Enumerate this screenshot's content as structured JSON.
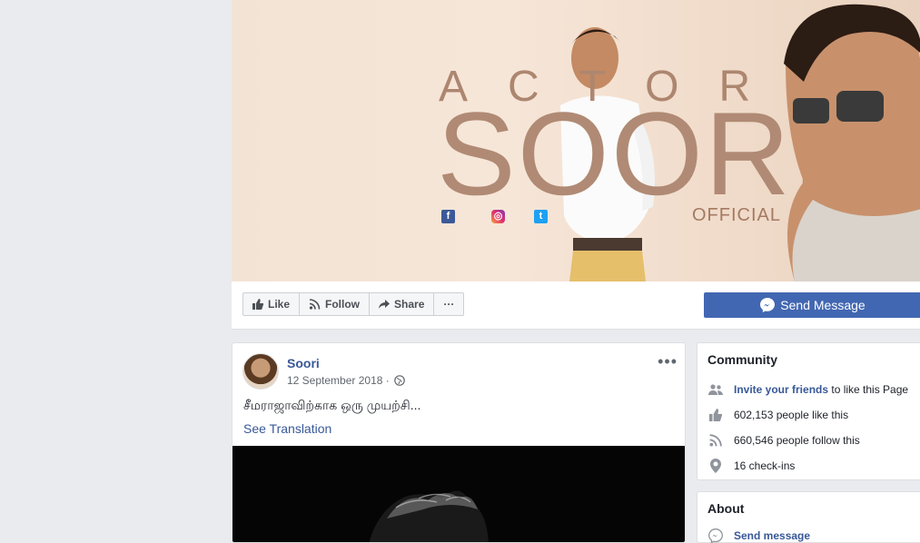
{
  "cover": {
    "top_text": "ACTOR",
    "name_text": "SOORI",
    "official_text": "OFFICIAL",
    "social_icons": [
      "facebook-icon",
      "instagram-icon",
      "twitter-icon"
    ]
  },
  "action_bar": {
    "like_label": "Like",
    "follow_label": "Follow",
    "share_label": "Share",
    "more_label": "···",
    "send_message_label": "Send Message"
  },
  "post": {
    "author": "Soori",
    "date": "12 September 2018 ·",
    "text": "சீமராஜாவிற்காக ஒரு முயற்சி...",
    "see_translation": "See Translation",
    "more_label": "•••"
  },
  "community": {
    "title": "Community",
    "invite_link": "Invite your friends",
    "invite_rest": " to like this Page",
    "likes": "602,153 people like this",
    "follows": "660,546 people follow this",
    "checkins": "16 check-ins"
  },
  "about": {
    "title": "About",
    "send_message": "Send message"
  },
  "colors": {
    "brand": "#4267b2",
    "link": "#385898",
    "page_bg": "#e9ebee"
  }
}
